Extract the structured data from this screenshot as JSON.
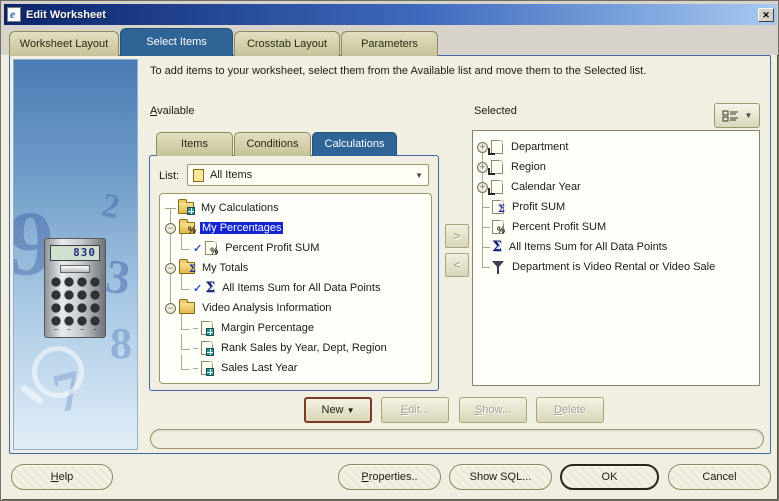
{
  "window": {
    "title": "Edit Worksheet",
    "close": "✕"
  },
  "colors": {
    "titlebar_start": "#0a246a",
    "titlebar_end": "#a6caf0",
    "active_tab_blue": "#2e6496",
    "selection_blue": "#1324d0",
    "panel_border_blue": "#3d68ac",
    "dialog_cream": "#f1efe2",
    "tab_tan": "#c6c298"
  },
  "main_tabs": {
    "worksheet_layout": "Worksheet Layout",
    "select_items": "Select Items",
    "crosstab_layout": "Crosstab Layout",
    "parameters": "Parameters"
  },
  "instruction": "To add items to your worksheet, select them from the Available list and move them to the Selected list.",
  "available": {
    "label": "Available",
    "tabs": {
      "items": "Items",
      "conditions": "Conditions",
      "calculations": "Calculations"
    },
    "list_label": "List:",
    "list_value": "All Items",
    "tree": [
      "My Calculations",
      "My Percentages",
      "Percent Profit SUM",
      "My Totals",
      "All Items Sum for All Data Points",
      "Video Analysis Information",
      "Margin Percentage",
      "Rank Sales by Year, Dept, Region",
      "Sales Last Year"
    ]
  },
  "selected": {
    "label": "Selected",
    "items": [
      "Department",
      "Region",
      "Calendar Year",
      "Profit SUM",
      "Percent Profit SUM",
      "All Items Sum for All Data Points",
      "Department is Video Rental or Video Sale"
    ]
  },
  "move": {
    "right": ">",
    "left": "<"
  },
  "actions": {
    "new": "New",
    "new_arrow": "▼",
    "edit": "Edit...",
    "show": "Show...",
    "delete": "Delete"
  },
  "footer": {
    "help": "Help",
    "properties": "Properties..",
    "show_sql": "Show SQL...",
    "ok": "OK",
    "cancel": "Cancel"
  },
  "left_panel": {
    "calculator_display": "830",
    "num_9": "9",
    "num_2": "2",
    "num_3": "3",
    "num_7": "7",
    "num_8": "8"
  }
}
